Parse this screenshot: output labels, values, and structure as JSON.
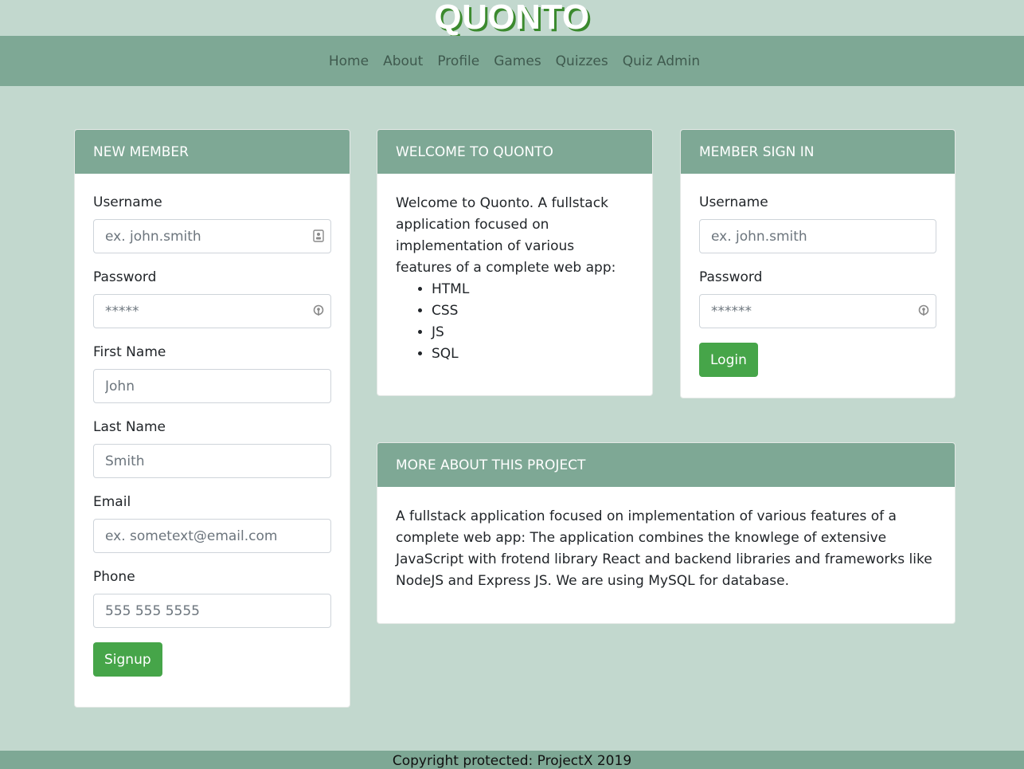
{
  "brand": {
    "title": "QUONTO"
  },
  "nav": {
    "items": [
      "Home",
      "About",
      "Profile",
      "Games",
      "Quizzes",
      "Quiz Admin"
    ]
  },
  "new_member": {
    "header": "NEW MEMBER",
    "username_label": "Username",
    "username_placeholder": "ex. john.smith",
    "password_label": "Password",
    "password_placeholder": "*****",
    "first_name_label": "First Name",
    "first_name_placeholder": "John",
    "last_name_label": "Last Name",
    "last_name_placeholder": "Smith",
    "email_label": "Email",
    "email_placeholder": "ex. sometext@email.com",
    "phone_label": "Phone",
    "phone_placeholder": "555 555 5555",
    "signup_label": "Signup"
  },
  "welcome": {
    "header": "WELCOME TO QUONTO",
    "text": "Welcome to Quonto. A fullstack application focused on implementation of various features of a complete web app:",
    "items": [
      "HTML",
      "CSS",
      "JS",
      "SQL"
    ]
  },
  "sign_in": {
    "header": "MEMBER SIGN IN",
    "username_label": "Username",
    "username_placeholder": "ex. john.smith",
    "password_label": "Password",
    "password_placeholder": "******",
    "login_label": "Login"
  },
  "about": {
    "header": "MORE ABOUT THIS PROJECT",
    "text": "A fullstack application focused on implementation of various features of a complete web app: The application combines the knowlege of extensive JavaScript with frotend library React and backend libraries and frameworks like NodeJS and Express JS. We are using MySQL for database."
  },
  "footer": {
    "text": "Copyright protected: ProjectX 2019"
  },
  "colors": {
    "background": "#c2d8ce",
    "header_green": "#7ea895",
    "button_green": "#46a549"
  }
}
